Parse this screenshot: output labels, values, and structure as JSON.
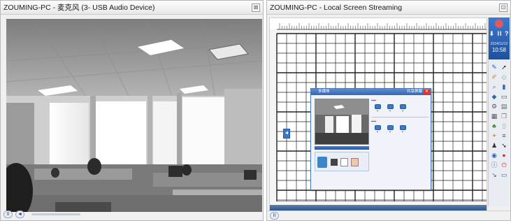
{
  "left_window": {
    "title": "ZOUMING-PC - 麦克风 (3- USB Audio Device)",
    "media_controls": [
      "play-pause",
      "volume"
    ]
  },
  "right_window": {
    "title": "ZOUMING-PC - Local Screen Streaming",
    "media_controls": [
      "play-pause"
    ]
  },
  "stream": {
    "side_panel": {
      "brand_color": "#2d64b8",
      "controls_label": "⬇ II ?",
      "date": "2024/11/12",
      "time": "10:58"
    },
    "dialog": {
      "title": "多媒体",
      "title_right": "共享屏幕"
    }
  },
  "colors": {
    "accent": "#2d64b8",
    "close_red": "#d23b32"
  }
}
